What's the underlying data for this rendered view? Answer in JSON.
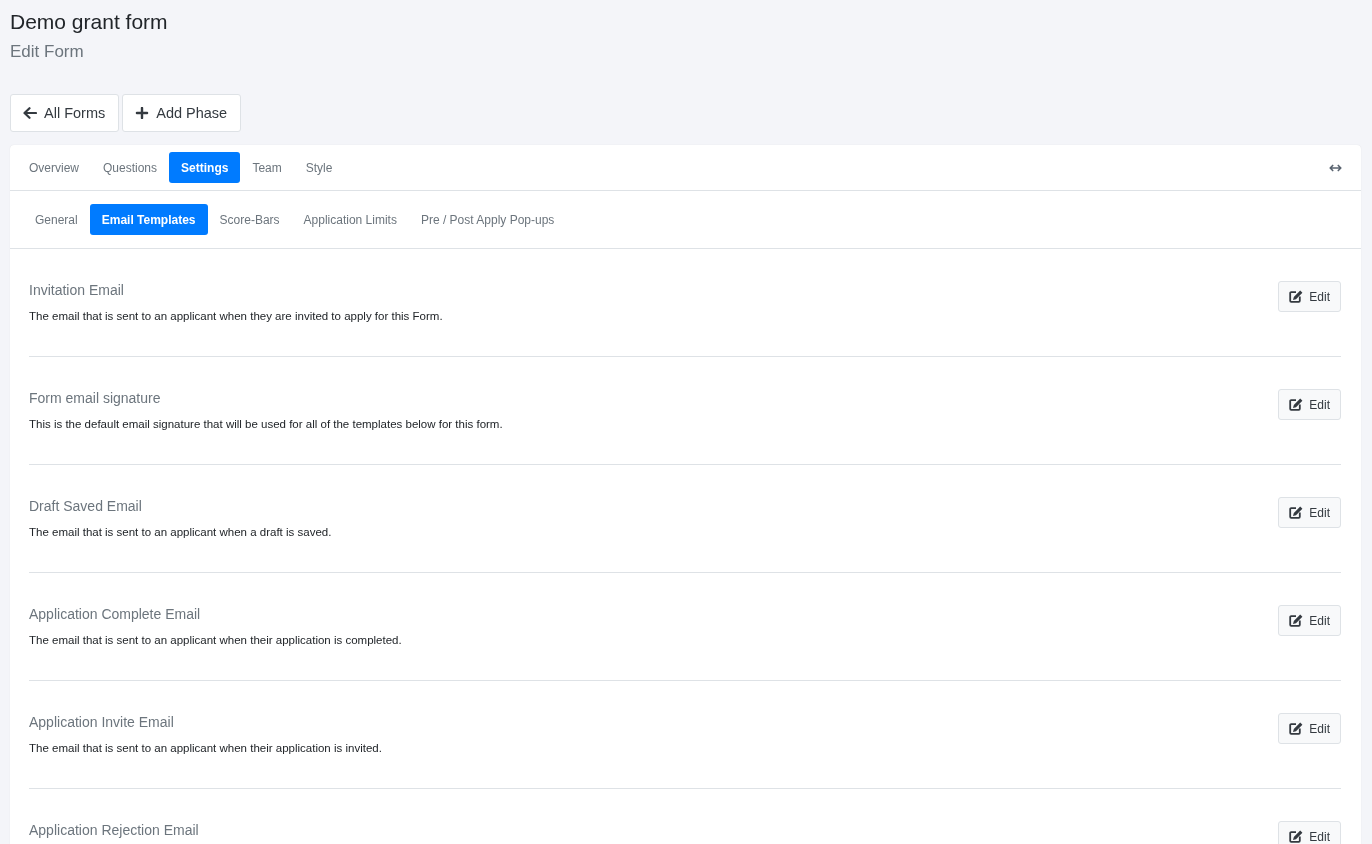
{
  "page": {
    "title": "Demo grant form",
    "subtitle": "Edit Form"
  },
  "actions": [
    {
      "kind": "back",
      "label": "All Forms"
    },
    {
      "kind": "add",
      "label": "Add Phase"
    }
  ],
  "tabs": [
    {
      "label": "Overview",
      "selected": false
    },
    {
      "label": "Questions",
      "selected": false
    },
    {
      "label": "Settings",
      "selected": true
    },
    {
      "label": "Team",
      "selected": false
    },
    {
      "label": "Style",
      "selected": false
    }
  ],
  "subtabs": [
    {
      "label": "General",
      "selected": false
    },
    {
      "label": "Email Templates",
      "selected": true
    },
    {
      "label": "Score-Bars",
      "selected": false
    },
    {
      "label": "Application Limits",
      "selected": false
    },
    {
      "label": "Pre / Post Apply Pop-ups",
      "selected": false
    }
  ],
  "email_templates": [
    {
      "title": "Invitation Email",
      "description": "The email that is sent to an applicant when they are invited to apply for this Form.",
      "button": "Edit"
    },
    {
      "title": "Form email signature",
      "description": "This is the default email signature that will be used for all of the templates below for this form.",
      "button": "Edit"
    },
    {
      "title": "Draft Saved Email",
      "description": "The email that is sent to an applicant when a draft is saved.",
      "button": "Edit"
    },
    {
      "title": "Application Complete Email",
      "description": "The email that is sent to an applicant when their application is completed.",
      "button": "Edit"
    },
    {
      "title": "Application Invite Email",
      "description": "The email that is sent to an applicant when their application is invited.",
      "button": "Edit"
    },
    {
      "title": "Application Rejection Email",
      "button": "Edit"
    }
  ]
}
